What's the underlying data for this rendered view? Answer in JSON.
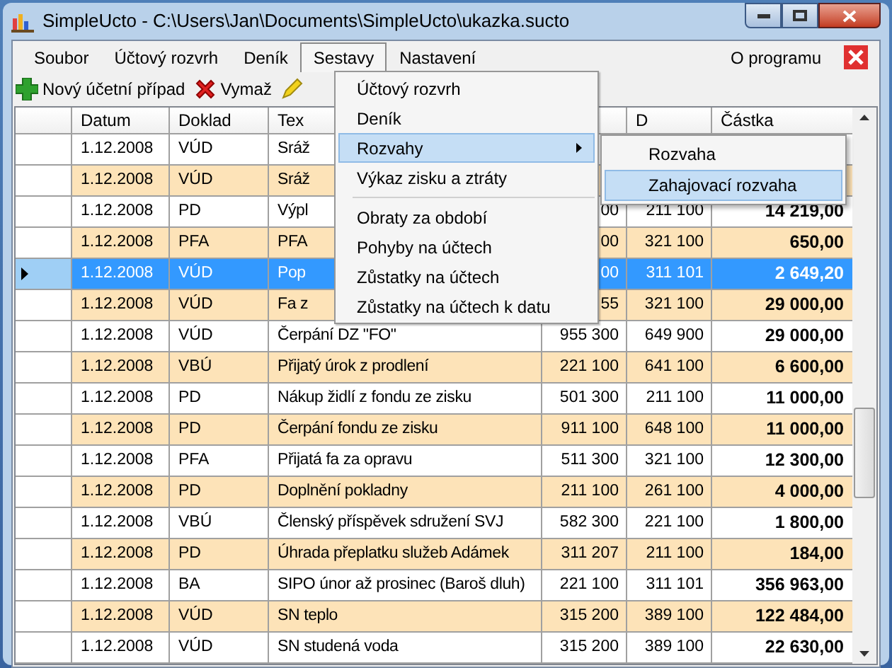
{
  "window": {
    "title": "SimpleUcto - C:\\Users\\Jan\\Documents\\SimpleUcto\\ukazka.sucto"
  },
  "menu": [
    {
      "label": "Soubor",
      "selected": false
    },
    {
      "label": "Účtový rozvrh",
      "selected": false
    },
    {
      "label": "Deník",
      "selected": false
    },
    {
      "label": "Sestavy",
      "selected": true
    },
    {
      "label": "Nastavení",
      "selected": false
    }
  ],
  "menu_right": {
    "label": "O programu"
  },
  "toolbar": [
    {
      "kind": "add",
      "label": "Nový účetní případ"
    },
    {
      "kind": "delete",
      "label": "Vymaž"
    },
    {
      "kind": "edit"
    }
  ],
  "dropdown": [
    {
      "kind": "item",
      "label": "Účtový rozvrh",
      "selected": false
    },
    {
      "kind": "item",
      "label": "Deník",
      "selected": false
    },
    {
      "kind": "submenu",
      "label": "Rozvahy",
      "selected": true
    },
    {
      "kind": "item",
      "label": "Výkaz zisku a ztráty",
      "selected": false
    },
    {
      "kind": "separator"
    },
    {
      "kind": "item",
      "label": "Obraty za období",
      "selected": false
    },
    {
      "kind": "item",
      "label": "Pohyby na účtech",
      "selected": false
    },
    {
      "kind": "item",
      "label": "Zůstatky na účtech",
      "selected": false
    },
    {
      "kind": "item",
      "label": "Zůstatky na účtech k datu",
      "selected": false
    }
  ],
  "submenu": [
    {
      "label": "Rozvaha",
      "selected": false
    },
    {
      "label": "Zahajovací rozvaha",
      "selected": true
    }
  ],
  "table": {
    "columns": [
      "Datum",
      "Doklad",
      "Tex",
      "",
      "D",
      "Částka"
    ],
    "rows": [
      {
        "selected": false,
        "cells": [
          "1.12.2008",
          "VÚD",
          "Sráž",
          "",
          "",
          ""
        ]
      },
      {
        "selected": false,
        "cells": [
          "1.12.2008",
          "VÚD",
          "Sráž",
          "",
          "",
          ""
        ]
      },
      {
        "selected": false,
        "cells": [
          "1.12.2008",
          "PD",
          "Výpl",
          "00",
          "211 100",
          "14 219,00"
        ]
      },
      {
        "selected": false,
        "cells": [
          "1.12.2008",
          "PFA",
          "PFA",
          "00",
          "321 100",
          "650,00"
        ]
      },
      {
        "selected": true,
        "cells": [
          "1.12.2008",
          "VÚD",
          "Pop",
          "00",
          "311 101",
          "2 649,20"
        ]
      },
      {
        "selected": false,
        "cells": [
          "1.12.2008",
          "VÚD",
          "Fa z",
          "55",
          "321 100",
          "29 000,00"
        ]
      },
      {
        "selected": false,
        "cells": [
          "1.12.2008",
          "VÚD",
          "Čerpání DZ \"FO\"",
          "955 300",
          "649 900",
          "29 000,00"
        ]
      },
      {
        "selected": false,
        "cells": [
          "1.12.2008",
          "VBÚ",
          "Přijatý úrok z prodlení",
          "221 100",
          "641 100",
          "6 600,00"
        ]
      },
      {
        "selected": false,
        "cells": [
          "1.12.2008",
          "PD",
          "Nákup židlí z fondu ze zisku",
          "501 300",
          "211 100",
          "11 000,00"
        ]
      },
      {
        "selected": false,
        "cells": [
          "1.12.2008",
          "PD",
          "Čerpání fondu ze zisku",
          "911 100",
          "648 100",
          "11 000,00"
        ]
      },
      {
        "selected": false,
        "cells": [
          "1.12.2008",
          "PFA",
          "Přijatá fa za opravu",
          "511 300",
          "321 100",
          "12 300,00"
        ]
      },
      {
        "selected": false,
        "cells": [
          "1.12.2008",
          "PD",
          "Doplnění pokladny",
          "211 100",
          "261 100",
          "4 000,00"
        ]
      },
      {
        "selected": false,
        "cells": [
          "1.12.2008",
          "VBÚ",
          "Členský příspěvek sdružení SVJ",
          "582 300",
          "221 100",
          "1 800,00"
        ]
      },
      {
        "selected": false,
        "cells": [
          "1.12.2008",
          "PD",
          "Úhrada přeplatku služeb Adámek",
          "311 207",
          "211 100",
          "184,00"
        ]
      },
      {
        "selected": false,
        "cells": [
          "1.12.2008",
          "BA",
          "SIPO únor až prosinec (Baroš dluh)",
          "221 100",
          "311 101",
          "356 963,00"
        ]
      },
      {
        "selected": false,
        "cells": [
          "1.12.2008",
          "VÚD",
          "SN teplo",
          "315 200",
          "389 100",
          "122 484,00"
        ]
      },
      {
        "selected": false,
        "cells": [
          "1.12.2008",
          "VÚD",
          "SN studená voda",
          "315 200",
          "389 100",
          "22 630,00"
        ]
      }
    ]
  }
}
